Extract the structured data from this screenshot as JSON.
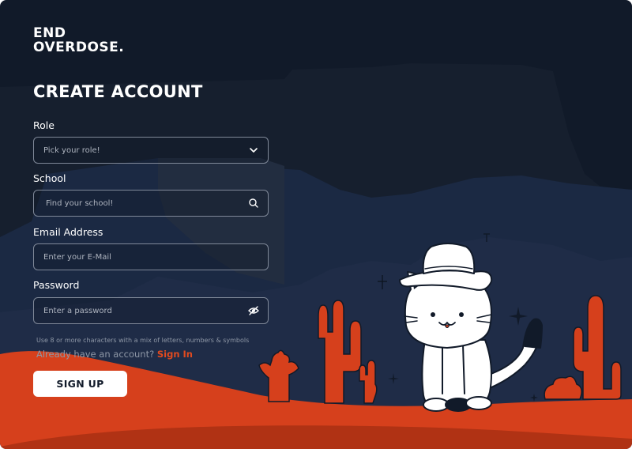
{
  "logo": {
    "line1": "END",
    "line2": "OVERDOSE."
  },
  "heading": "CREATE ACCOUNT",
  "form": {
    "role": {
      "label": "Role",
      "placeholder": "Pick your role!"
    },
    "school": {
      "label": "School",
      "placeholder": "Find your school!"
    },
    "email": {
      "label": "Email Address",
      "placeholder": "Enter your E-Mail"
    },
    "password": {
      "label": "Password",
      "placeholder": "Enter a password",
      "hint": "Use 8 or more characters with a mix of letters, numbers & symbols"
    },
    "signin_prompt": "Already have an account?",
    "signin_link": "Sign In",
    "submit_label": "SIGN UP"
  },
  "icons": {
    "role": "chevron-down-icon",
    "school": "search-icon",
    "password": "eye-off-icon"
  },
  "colors": {
    "background": "#111a29",
    "accent": "#e14a1f",
    "field_border": "#7f8898",
    "button": "#ffffff"
  }
}
